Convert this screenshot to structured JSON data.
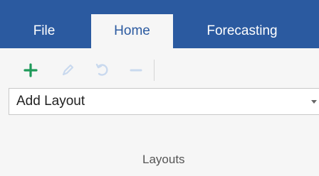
{
  "ribbon": {
    "tabs": [
      {
        "label": "File"
      },
      {
        "label": "Home",
        "selected": true
      },
      {
        "label": "Forecasting"
      }
    ],
    "toolbar": {
      "buttons": [
        {
          "icon": "plus-icon",
          "color": "#1f9a5a"
        },
        {
          "icon": "pencil-icon",
          "color": "#c9d9ee"
        },
        {
          "icon": "undo-icon",
          "color": "#c9d9ee"
        },
        {
          "icon": "minus-icon",
          "color": "#c9d9ee"
        }
      ]
    },
    "layout_select": {
      "value": "Add Layout"
    },
    "group_label": "Layouts"
  },
  "colors": {
    "tab_bar": "#2b5aa0",
    "ribbon_background": "#f6f6f6",
    "active_icon": "#1f9a5a",
    "disabled_icon": "#c9d9ee"
  }
}
